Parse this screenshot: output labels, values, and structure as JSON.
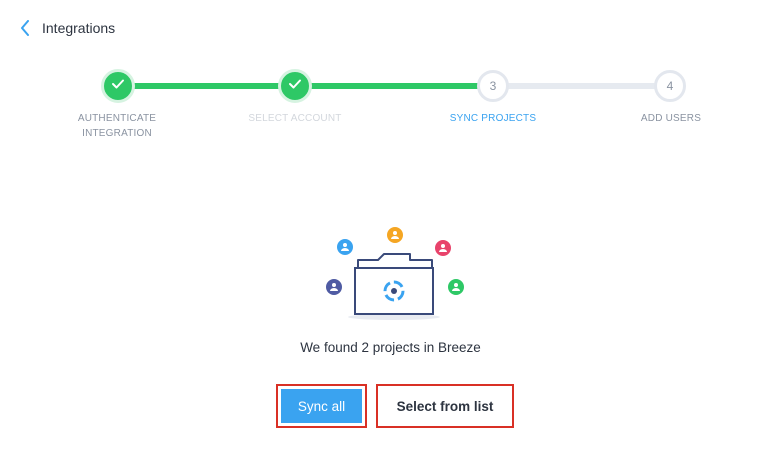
{
  "header": {
    "back_icon": "chevron-left-icon",
    "title": "Integrations"
  },
  "stepper": {
    "steps": [
      {
        "number": "1",
        "label": "AUTHENTICATE INTEGRATION",
        "state": "completed"
      },
      {
        "number": "2",
        "label": "SELECT ACCOUNT",
        "state": "completed"
      },
      {
        "number": "3",
        "label": "SYNC PROJECTS",
        "state": "active"
      },
      {
        "number": "4",
        "label": "ADD USERS",
        "state": "pending"
      }
    ],
    "colors": {
      "complete": "#2ec866",
      "active": "#3aa3f0",
      "pending": "#e3e7ee"
    }
  },
  "illustration": {
    "icon": "folder-with-users-icon",
    "avatar_colors": [
      "#4f5ba3",
      "#3aa3f0",
      "#f5a623",
      "#e8436b",
      "#2ec866"
    ]
  },
  "message": "We found 2 projects in Breeze",
  "actions": {
    "sync_all": "Sync all",
    "select_from_list": "Select from list"
  }
}
